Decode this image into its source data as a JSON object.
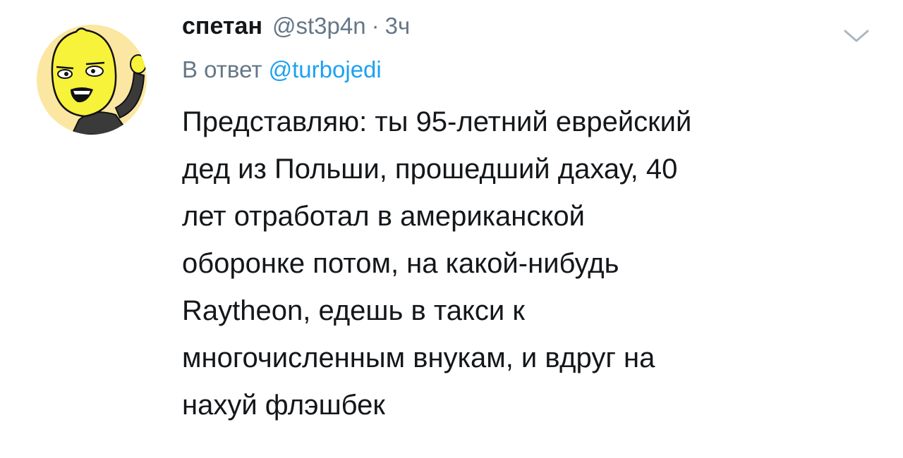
{
  "tweet": {
    "display_name": "спетан",
    "handle": "@st3p4n",
    "separator": "·",
    "time": "3ч",
    "reply_prefix": "В ответ",
    "reply_to": "@turbojedi",
    "text": "Представляю: ты 95-летний еврейский\nдед из Польши, прошедший дахау, 40\nлет отработал в американской\nоборонке потом, на какой-нибудь\nRaytheon, едешь в такси к\nмногочисленным внукам, и вдруг на\nнахуй флэшбек",
    "menu_icon": "chevron-down-icon",
    "avatar_icon": "lemon-character-avatar"
  },
  "colors": {
    "accent": "#1da1f2",
    "secondary_text": "#657786",
    "primary_text": "#14171a",
    "avatar_bg": "#fbe7a1",
    "lemon": "#f7f23a"
  }
}
